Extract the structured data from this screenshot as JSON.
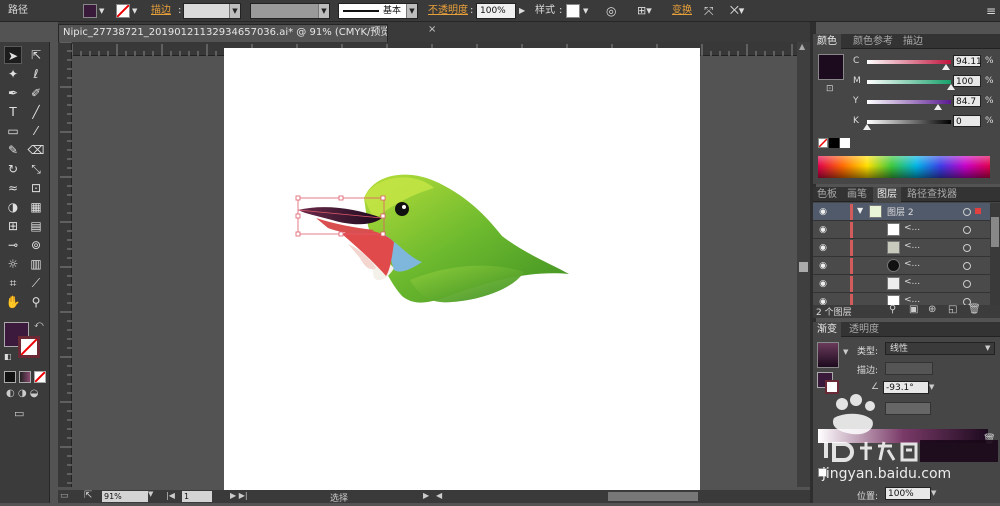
{
  "controlbar": {
    "tool_name": "路径",
    "stroke_label": "描边",
    "stroke_style": "基本",
    "opacity_label": "不透明度",
    "opacity_value": "100%",
    "style_label": "样式",
    "transform_label": "变换"
  },
  "document": {
    "tab_title": "Nipic_27738721_20190121132934657036.ai* @ 91% (CMYK/预览)",
    "close_glyph": "×"
  },
  "tools": {
    "icons": [
      "selection-arrow-icon",
      "direct-selection-icon",
      "magic-wand-icon",
      "lasso-icon",
      "pen-icon",
      "curvature-icon",
      "type-icon",
      "line-segment-icon",
      "rectangle-icon",
      "paintbrush-icon",
      "pencil-icon",
      "eraser-icon",
      "rotate-icon",
      "scale-icon",
      "warp-icon",
      "free-transform-icon",
      "shape-builder-icon",
      "perspective-grid-icon",
      "mesh-icon",
      "gradient-icon",
      "eyedropper-icon",
      "blend-icon",
      "symbol-sprayer-icon",
      "column-graph-icon",
      "artboard-icon",
      "slice-icon",
      "hand-icon",
      "zoom-icon"
    ]
  },
  "color_panel": {
    "tabs": [
      "颜色",
      "颜色参考",
      "描边"
    ],
    "active_tab": 0,
    "channels": [
      {
        "label": "C",
        "value": "94.11",
        "fill": 0.94,
        "color": "#c0143c"
      },
      {
        "label": "M",
        "value": "100",
        "fill": 1.0,
        "color": "#17a06a"
      },
      {
        "label": "Y",
        "value": "84.7",
        "fill": 0.85,
        "color": "#5a1a90"
      },
      {
        "label": "K",
        "value": "0",
        "fill": 0.0,
        "color": "#000000"
      }
    ],
    "percent_sign": "%",
    "fill_color": "#1c0a1e"
  },
  "layers_panel": {
    "tabs": [
      "色板",
      "画笔",
      "图层",
      "路径查找器"
    ],
    "active_tab": 2,
    "layer_name": "图层 2",
    "sublayer_label": "<...",
    "count_text": "2 个图层",
    "sublayer_count": 5
  },
  "gradient_panel": {
    "tabs": [
      "渐变",
      "透明度"
    ],
    "active_tab": 0,
    "type_label": "类型:",
    "type_value": "线性",
    "stroke_label": "描边:",
    "angle_value": "-93.1°",
    "location_label": "位置:",
    "location_value": "100%"
  },
  "statusbar": {
    "zoom": "91%",
    "page": "1",
    "status": "选择"
  },
  "watermark": {
    "brand": "jingyan.baidu.com"
  }
}
